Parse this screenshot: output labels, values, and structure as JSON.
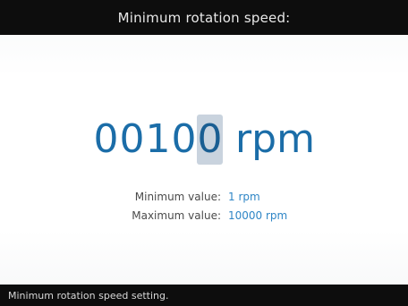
{
  "header": {
    "title": "Minimum rotation speed:"
  },
  "editor": {
    "digits": [
      "0",
      "0",
      "1",
      "0",
      "0"
    ],
    "active_digit_index": 4,
    "unit": "rpm"
  },
  "limits": {
    "min_label": "Minimum value:",
    "min_value": "1 rpm",
    "max_label": "Maximum value:",
    "max_value": "10000 rpm"
  },
  "status": {
    "text": "Minimum rotation speed setting."
  },
  "colors": {
    "value_blue": "#1b6da8",
    "limit_blue": "#2f86c6",
    "bar_background": "#0d0d0d",
    "active_digit_highlight": "#c9d3de"
  }
}
